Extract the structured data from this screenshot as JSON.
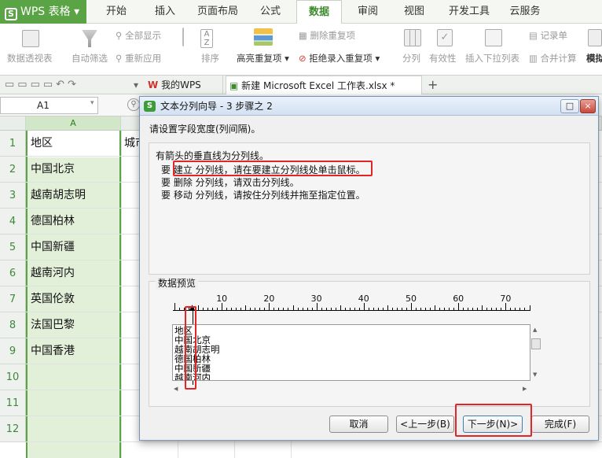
{
  "menubar": {
    "app_name": "WPS 表格",
    "tabs": [
      "开始",
      "插入",
      "页面布局",
      "公式",
      "数据",
      "审阅",
      "视图",
      "开发工具",
      "云服务"
    ],
    "active_tab": "数据"
  },
  "ribbon": {
    "pivot": "数据透视表",
    "autofilter": "自动筛选",
    "show_all": "全部显示",
    "reapply": "重新应用",
    "sort": "排序",
    "highlight_dup": "高亮重复项",
    "delete_dup": "删除重复项",
    "reject_dup": "拒绝录入重复项",
    "split": "分列",
    "validity": "有效性",
    "insert_dropdown": "插入下拉列表",
    "record_form": "记录单",
    "consolidate": "合并计算",
    "simulate": "模拟"
  },
  "tabbar": {
    "doc1": "我的WPS",
    "doc2": "新建 Microsoft Excel 工作表.xlsx *",
    "add": "+"
  },
  "formula": {
    "cell_ref": "A1"
  },
  "sheet": {
    "col_a": "A",
    "rows": [
      "1",
      "2",
      "3",
      "4",
      "5",
      "6",
      "7",
      "8",
      "9",
      "10",
      "11",
      "12"
    ],
    "a_values": [
      "地区",
      "中国北京",
      "越南胡志明",
      "德国柏林",
      "中国新疆",
      "越南河内",
      "英国伦敦",
      "法国巴黎",
      "中国香港"
    ],
    "b1": "城市"
  },
  "dialog": {
    "title": "文本分列向导 - 3 步骤之 2",
    "prompt": "请设置字段宽度(列间隔)。",
    "help_title": "有箭头的垂直线为分列线。",
    "help_lines": [
      "要 建立 分列线，请在要建立分列线处单击鼠标。",
      "要 删除 分列线，请双击分列线。",
      "要 移动 分列线，请按住分列线并拖至指定位置。"
    ],
    "preview_label": "数据预览",
    "ruler": [
      "10",
      "20",
      "30",
      "40",
      "50",
      "60",
      "70"
    ],
    "preview_rows": [
      "地区",
      "中国北京",
      "越南胡志明",
      "德国柏林",
      "中国新疆",
      "越南河内"
    ],
    "buttons": {
      "cancel": "取消",
      "prev": "<上一步(B)",
      "next": "下一步(N)>",
      "finish": "完成(F)"
    },
    "window_buttons": [
      "–",
      "□",
      "×"
    ]
  },
  "colors": {
    "accent": "#5aa446",
    "highlight": "#e52525",
    "selected_col": "#e2f0d9"
  }
}
